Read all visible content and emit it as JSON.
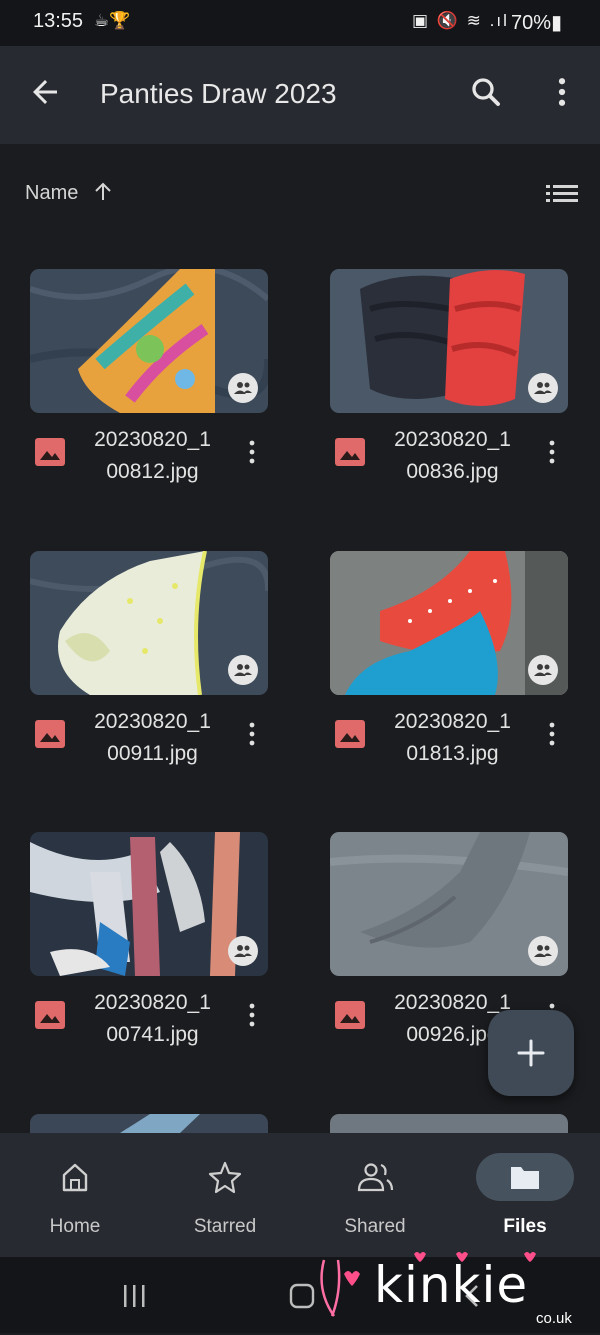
{
  "status_bar": {
    "time": "13:55",
    "left_icons": "☕🏆",
    "right_icons": "▣ 🔇 ≋ .ıl",
    "battery": "70%▮"
  },
  "app_bar": {
    "title": "Panties Draw 2023",
    "back_icon": "arrow-left-icon",
    "search_icon": "search-icon",
    "more_icon": "more-vertical-icon"
  },
  "sort": {
    "label": "Name",
    "direction_icon": "arrow-up-icon",
    "view_icon": "list-view-icon"
  },
  "files": [
    {
      "name": "20230820_1\n00812.jpg",
      "shared_icon": "people-icon",
      "type_icon": "image-icon"
    },
    {
      "name": "20230820_1\n00836.jpg",
      "shared_icon": "people-icon",
      "type_icon": "image-icon"
    },
    {
      "name": "20230820_1\n00911.jpg",
      "shared_icon": "people-icon",
      "type_icon": "image-icon"
    },
    {
      "name": "20230820_1\n01813.jpg",
      "shared_icon": "people-icon",
      "type_icon": "image-icon"
    },
    {
      "name": "20230820_1\n00741.jpg",
      "shared_icon": "people-icon",
      "type_icon": "image-icon"
    },
    {
      "name": "20230820_1\n00926.jpg",
      "shared_icon": "people-icon",
      "type_icon": "image-icon"
    }
  ],
  "fab": {
    "icon": "plus-icon"
  },
  "bottom_nav": [
    {
      "label": "Home",
      "icon": "home-icon",
      "active": false
    },
    {
      "label": "Starred",
      "icon": "star-icon",
      "active": false
    },
    {
      "label": "Shared",
      "icon": "people-icon",
      "active": false
    },
    {
      "label": "Files",
      "icon": "folder-icon",
      "active": true
    }
  ],
  "watermark": {
    "brand": "kinkie",
    "domain": "co.uk"
  },
  "colors": {
    "accent_image_icon": "#e06a6a",
    "appbar": "#272a30",
    "background": "#1b1c1f"
  }
}
